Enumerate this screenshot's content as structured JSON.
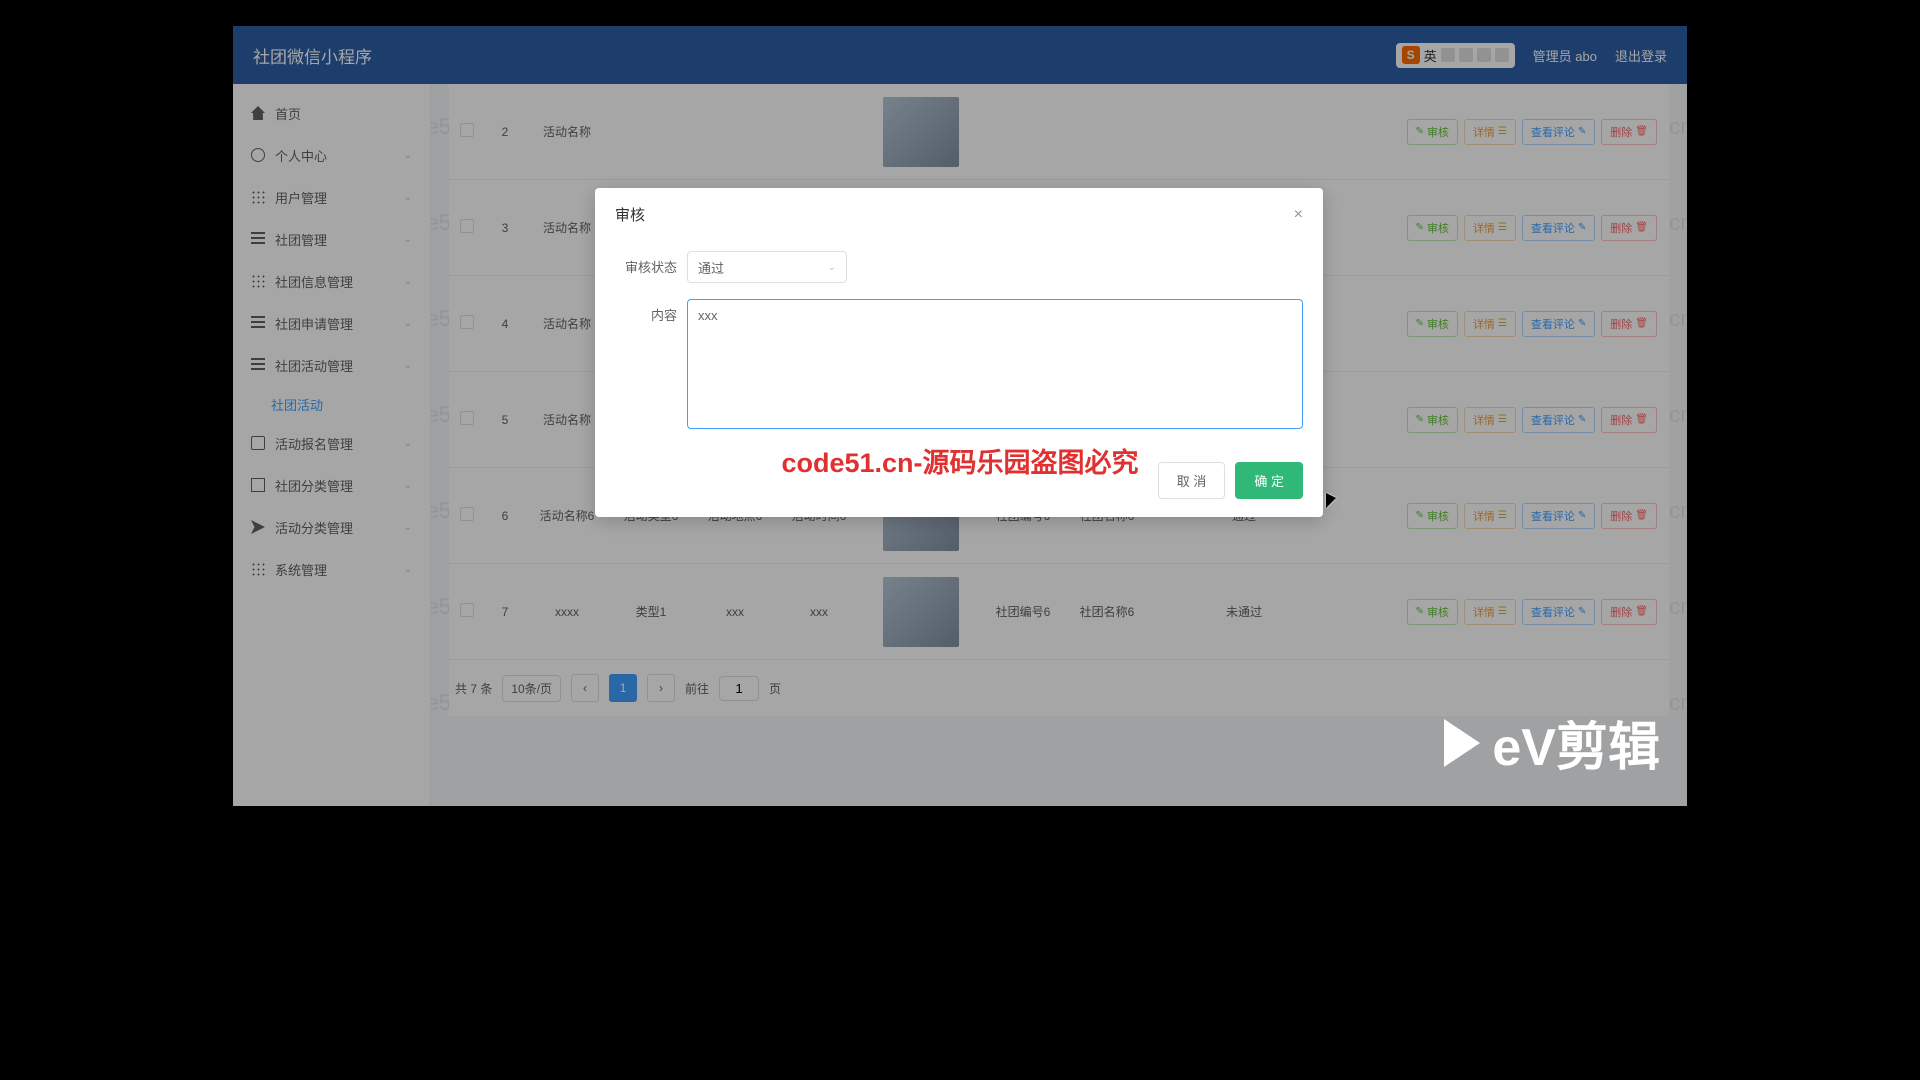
{
  "header": {
    "brand": "社团微信小程序",
    "user": "管理员 abo",
    "logout": "退出登录",
    "ime_lang": "英"
  },
  "sidebar": [
    {
      "icon": "icon-home",
      "label": "首页",
      "arrow": false
    },
    {
      "icon": "icon-user",
      "label": "个人中心",
      "arrow": true
    },
    {
      "icon": "icon-grid",
      "label": "用户管理",
      "arrow": true
    },
    {
      "icon": "icon-bars",
      "label": "社团管理",
      "arrow": true
    },
    {
      "icon": "icon-grid",
      "label": "社团信息管理",
      "arrow": true
    },
    {
      "icon": "icon-bars",
      "label": "社团申请管理",
      "arrow": true
    },
    {
      "icon": "icon-bars",
      "label": "社团活动管理",
      "arrow": true,
      "expanded": true,
      "sub": "社团活动"
    },
    {
      "icon": "icon-monitor",
      "label": "活动报名管理",
      "arrow": true
    },
    {
      "icon": "icon-doc",
      "label": "社团分类管理",
      "arrow": true
    },
    {
      "icon": "icon-send",
      "label": "活动分类管理",
      "arrow": true
    },
    {
      "icon": "icon-grid",
      "label": "系统管理",
      "arrow": true
    }
  ],
  "rows": [
    {
      "idx": "2",
      "name": "活动名称",
      "type": "",
      "loc": "",
      "time": "",
      "code": "",
      "club": "",
      "status": ""
    },
    {
      "idx": "3",
      "name": "活动名称",
      "type": "",
      "loc": "",
      "time": "",
      "code": "",
      "club": "",
      "status": ""
    },
    {
      "idx": "4",
      "name": "活动名称",
      "type": "",
      "loc": "",
      "time": "",
      "code": "",
      "club": "",
      "status": ""
    },
    {
      "idx": "5",
      "name": "活动名称",
      "type": "",
      "loc": "",
      "time": "",
      "code": "",
      "club": "",
      "status": ""
    },
    {
      "idx": "6",
      "name": "活动名称6",
      "type": "活动类型6",
      "loc": "活动地点6",
      "time": "活动时间6",
      "code": "社团编号6",
      "club": "社团名称6",
      "status": "通过"
    },
    {
      "idx": "7",
      "name": "xxxx",
      "type": "类型1",
      "loc": "xxx",
      "time": "xxx",
      "code": "社团编号6",
      "club": "社团名称6",
      "status": "未通过"
    }
  ],
  "ops": {
    "audit": "审核",
    "detail": "详情",
    "comment": "查看评论",
    "delete": "删除"
  },
  "pager": {
    "total": "共 7 条",
    "pagesize": "10条/页",
    "page": "1",
    "goto": "前往",
    "page_suffix": "页",
    "current": "1"
  },
  "dialog": {
    "title": "审核",
    "status_label": "审核状态",
    "status_value": "通过",
    "content_label": "内容",
    "content_value": "xxx",
    "cancel": "取 消",
    "confirm": "确 定"
  },
  "watermark_text": "code51.cn",
  "big_watermark": "code51.cn-源码乐园盗图必究",
  "ev": "eV剪辑"
}
